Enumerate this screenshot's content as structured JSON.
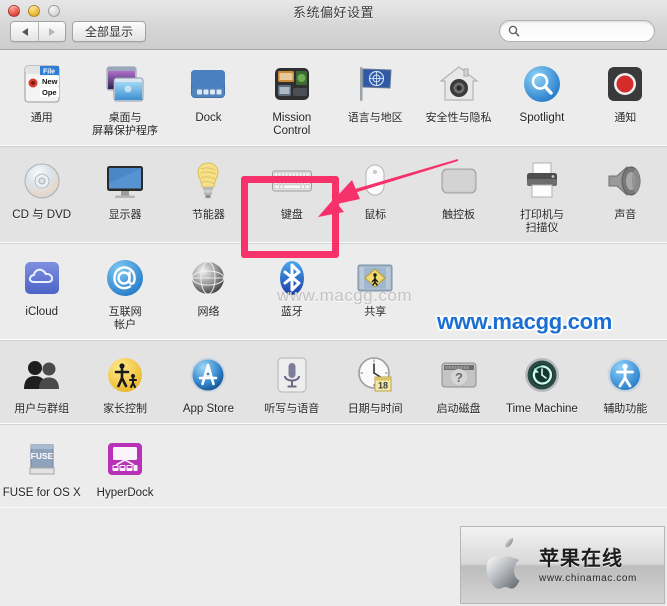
{
  "window": {
    "title": "系统偏好设置",
    "controls": {
      "close": "close-button",
      "minimize": "minimize-button",
      "zoom": "zoom-button"
    }
  },
  "toolbar": {
    "back_label": "back-arrow",
    "forward_label": "forward-arrow",
    "show_all_label": "全部显示",
    "search": {
      "value": "",
      "placeholder": ""
    }
  },
  "rows": [
    {
      "items": [
        {
          "label": "通用",
          "icon": "general-icon"
        },
        {
          "label": "桌面与\n屏幕保护程序",
          "icon": "desktop-screensaver-icon"
        },
        {
          "label": "Dock",
          "icon": "dock-icon"
        },
        {
          "label": "Mission\nControl",
          "icon": "mission-control-icon"
        },
        {
          "label": "语言与地区",
          "icon": "language-region-icon"
        },
        {
          "label": "安全性与隐私",
          "icon": "security-privacy-icon"
        },
        {
          "label": "Spotlight",
          "icon": "spotlight-icon"
        },
        {
          "label": "通知",
          "icon": "notifications-icon"
        }
      ]
    },
    {
      "items": [
        {
          "label": "CD 与 DVD",
          "icon": "cd-dvd-icon"
        },
        {
          "label": "显示器",
          "icon": "displays-icon"
        },
        {
          "label": "节能器",
          "icon": "energy-saver-icon"
        },
        {
          "label": "键盘",
          "icon": "keyboard-icon"
        },
        {
          "label": "鼠标",
          "icon": "mouse-icon"
        },
        {
          "label": "触控板",
          "icon": "trackpad-icon"
        },
        {
          "label": "打印机与\n扫描仪",
          "icon": "printers-scanners-icon"
        },
        {
          "label": "声音",
          "icon": "sound-icon"
        }
      ]
    },
    {
      "items": [
        {
          "label": "iCloud",
          "icon": "icloud-icon"
        },
        {
          "label": "互联网\n帐户",
          "icon": "internet-accounts-icon"
        },
        {
          "label": "网络",
          "icon": "network-icon"
        },
        {
          "label": "蓝牙",
          "icon": "bluetooth-icon"
        },
        {
          "label": "共享",
          "icon": "sharing-icon"
        }
      ]
    },
    {
      "items": [
        {
          "label": "用户与群组",
          "icon": "users-groups-icon"
        },
        {
          "label": "家长控制",
          "icon": "parental-controls-icon"
        },
        {
          "label": "App Store",
          "icon": "app-store-icon"
        },
        {
          "label": "听写与语音",
          "icon": "dictation-speech-icon"
        },
        {
          "label": "日期与时间",
          "icon": "date-time-icon",
          "badge": "18"
        },
        {
          "label": "启动磁盘",
          "icon": "startup-disk-icon"
        },
        {
          "label": "Time Machine",
          "icon": "time-machine-icon"
        },
        {
          "label": "辅助功能",
          "icon": "accessibility-icon"
        }
      ]
    },
    {
      "items": [
        {
          "label": "FUSE for OS X",
          "icon": "fuse-icon",
          "badge_text": "FUSE"
        },
        {
          "label": "HyperDock",
          "icon": "hyperdock-icon"
        }
      ]
    }
  ],
  "annotations": {
    "highlight_target": "键盘",
    "highlight_color": "#f7326b",
    "arrow_color": "#f7326b"
  },
  "watermarks": {
    "gray_text": "www.macgg.com",
    "blue_text": "www.macgg.com",
    "blue_color": "#1a6fd4"
  },
  "logo_banner": {
    "cn_text": "苹果在线",
    "url_text": "www.chinamac.com"
  }
}
